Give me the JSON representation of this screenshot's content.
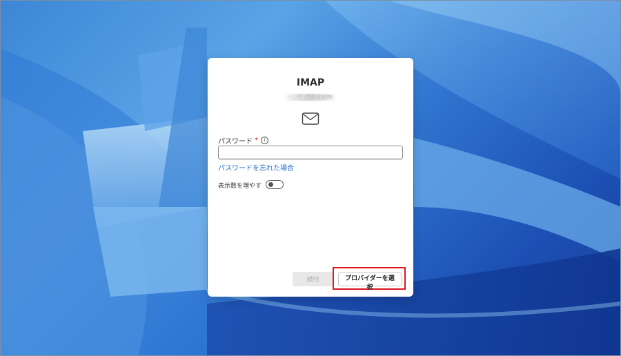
{
  "dialog": {
    "title": "IMAP",
    "account": "·· ·ᵍ ·ᵃ·l·com",
    "password_label": "パスワード",
    "required_mark": "*",
    "info_glyph": "i",
    "password_value": "",
    "forgot_link": "パスワードを忘れた場合",
    "show_more_label": "表示数を増やす",
    "show_more_on": false,
    "continue_label": "続行",
    "provider_label": "プロバイダーを選択"
  },
  "icons": {
    "mail": "mail-icon",
    "info": "info-icon"
  },
  "colors": {
    "link": "#1f6cc7",
    "required": "#c42b1c",
    "highlight": "#e0141b"
  }
}
